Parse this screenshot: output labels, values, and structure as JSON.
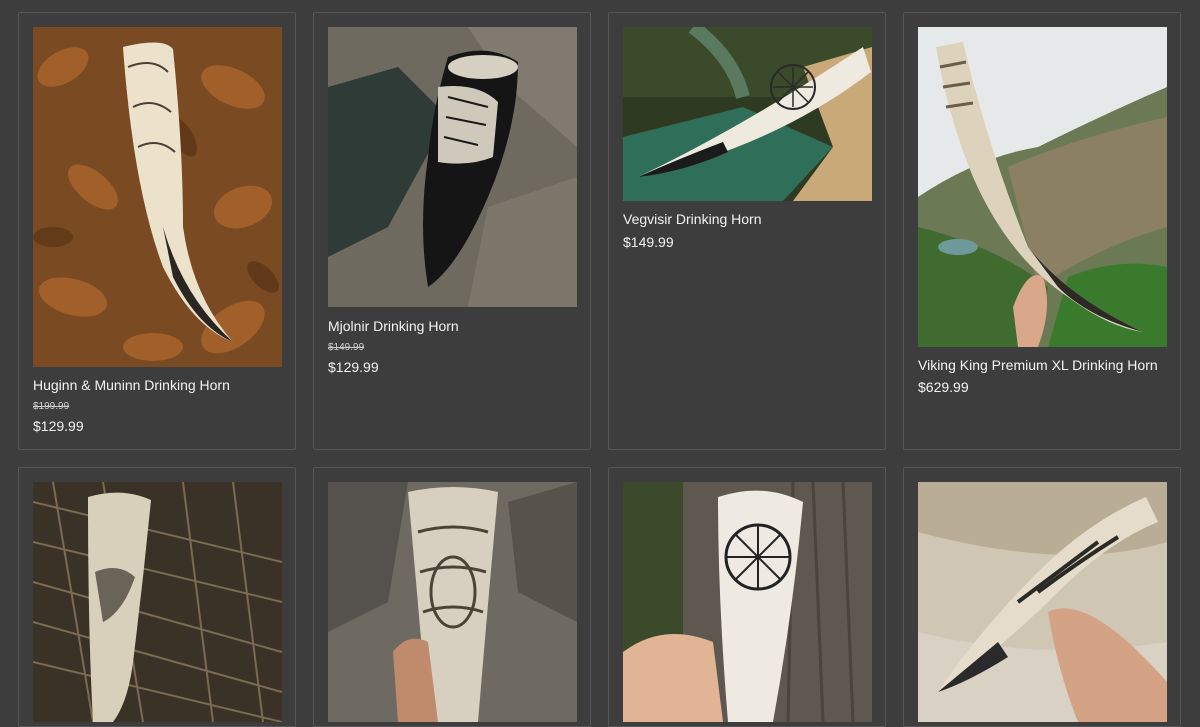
{
  "products": [
    {
      "title": "Huginn & Muninn Drinking Horn",
      "old_price": "$199.99",
      "price": "$129.99",
      "image": "horn-on-autumn-leaves"
    },
    {
      "title": "Mjolnir Drinking Horn",
      "old_price": "$149.99",
      "price": "$129.99",
      "image": "dark-horn-on-rock"
    },
    {
      "title": "Vegvisir Drinking Horn",
      "old_price": "",
      "price": "$149.99",
      "image": "horn-on-green-stone-stand"
    },
    {
      "title": "Viking King Premium XL Drinking Horn",
      "old_price": "",
      "price": "$629.99",
      "image": "horn-held-over-quarry"
    },
    {
      "image": "horn-on-thatch"
    },
    {
      "image": "carved-horn-held-on-rocks"
    },
    {
      "image": "sun-wheel-horn-by-tree"
    },
    {
      "image": "horn-held-over-fur"
    }
  ],
  "colors": {
    "background": "#3d3d3d",
    "card_border": "#555555",
    "text": "#f3f3f3"
  }
}
